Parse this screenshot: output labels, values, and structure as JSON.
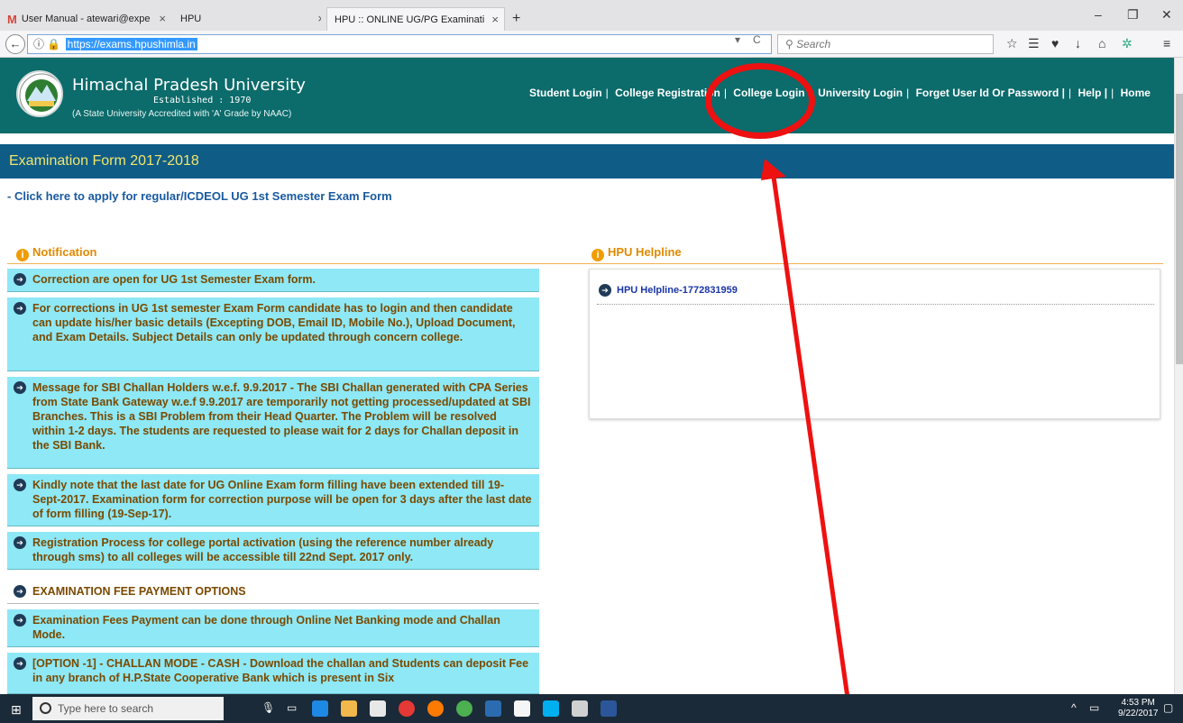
{
  "browser": {
    "tabs": [
      {
        "label": "User Manual - atewari@expe",
        "icon": "gmail-icon"
      },
      {
        "label": "HPU"
      },
      {
        "label": "HPU :: ONLINE UG/PG Examinati",
        "active": true
      }
    ],
    "new_tab": "+",
    "url": "https://exams.hpushimla.in",
    "search_placeholder": "Search"
  },
  "header": {
    "university_name": "Himachal Pradesh University",
    "established": "Established : 1970",
    "subtitle": "(A State University Accredited with 'A' Grade by NAAC)",
    "nav": [
      "Student Login",
      "College Registration",
      "College Login",
      "University Login",
      "Forget User Id Or Password |",
      "Help |",
      "Home"
    ]
  },
  "page": {
    "form_title": "Examination Form 2017-2018",
    "apply_link": "- Click here to apply for regular/ICDEOL UG 1st Semester Exam Form",
    "notification_heading": "Notification",
    "helpline_heading": "HPU Helpline",
    "helpline_item": "HPU Helpline-1772831959",
    "notifications": [
      "Correction are open for UG 1st Semester Exam form.",
      "For corrections in UG 1st semester Exam Form candidate has to login and then candidate can update his/her basic details (Excepting DOB, Email ID, Mobile No.), Upload Document, and Exam Details. Subject Details can only be updated through concern college.",
      "Message for SBI Challan Holders w.e.f. 9.9.2017 - The SBI Challan generated with CPA Series from State Bank Gateway w.e.f 9.9.2017 are temporarily not getting processed/updated at SBI Branches. This is a SBI Problem from their Head Quarter. The Problem will be resolved within 1-2 days. The students are requested to please wait for 2 days for Challan deposit in the SBI Bank.",
      "Kindly note that the last date for UG Online Exam form filling have been extended till 19-Sept-2017. Examination form for correction purpose will be open for 3 days after the last date of form filling (19-Sep-17).",
      "Registration Process for college portal activation (using the reference number already through sms) to all colleges will be accessible till 22nd Sept. 2017 only.",
      "EXAMINATION FEE PAYMENT OPTIONS",
      "Examination Fees Payment can be done through Online Net Banking mode and Challan Mode.",
      "[OPTION -1] - CHALLAN MODE - CASH - Download the challan and Students can deposit Fee in any branch of H.P.State Cooperative Bank which is present in Six"
    ]
  },
  "taskbar": {
    "search_placeholder": "Type here to search",
    "time": "4:53 PM",
    "date": "9/22/2017"
  },
  "colors": {
    "header_bg": "#0c6b6b",
    "title_strip": "#0f5c87",
    "notice_bg": "#8ee8f6",
    "annotation_red": "#ee1111"
  }
}
